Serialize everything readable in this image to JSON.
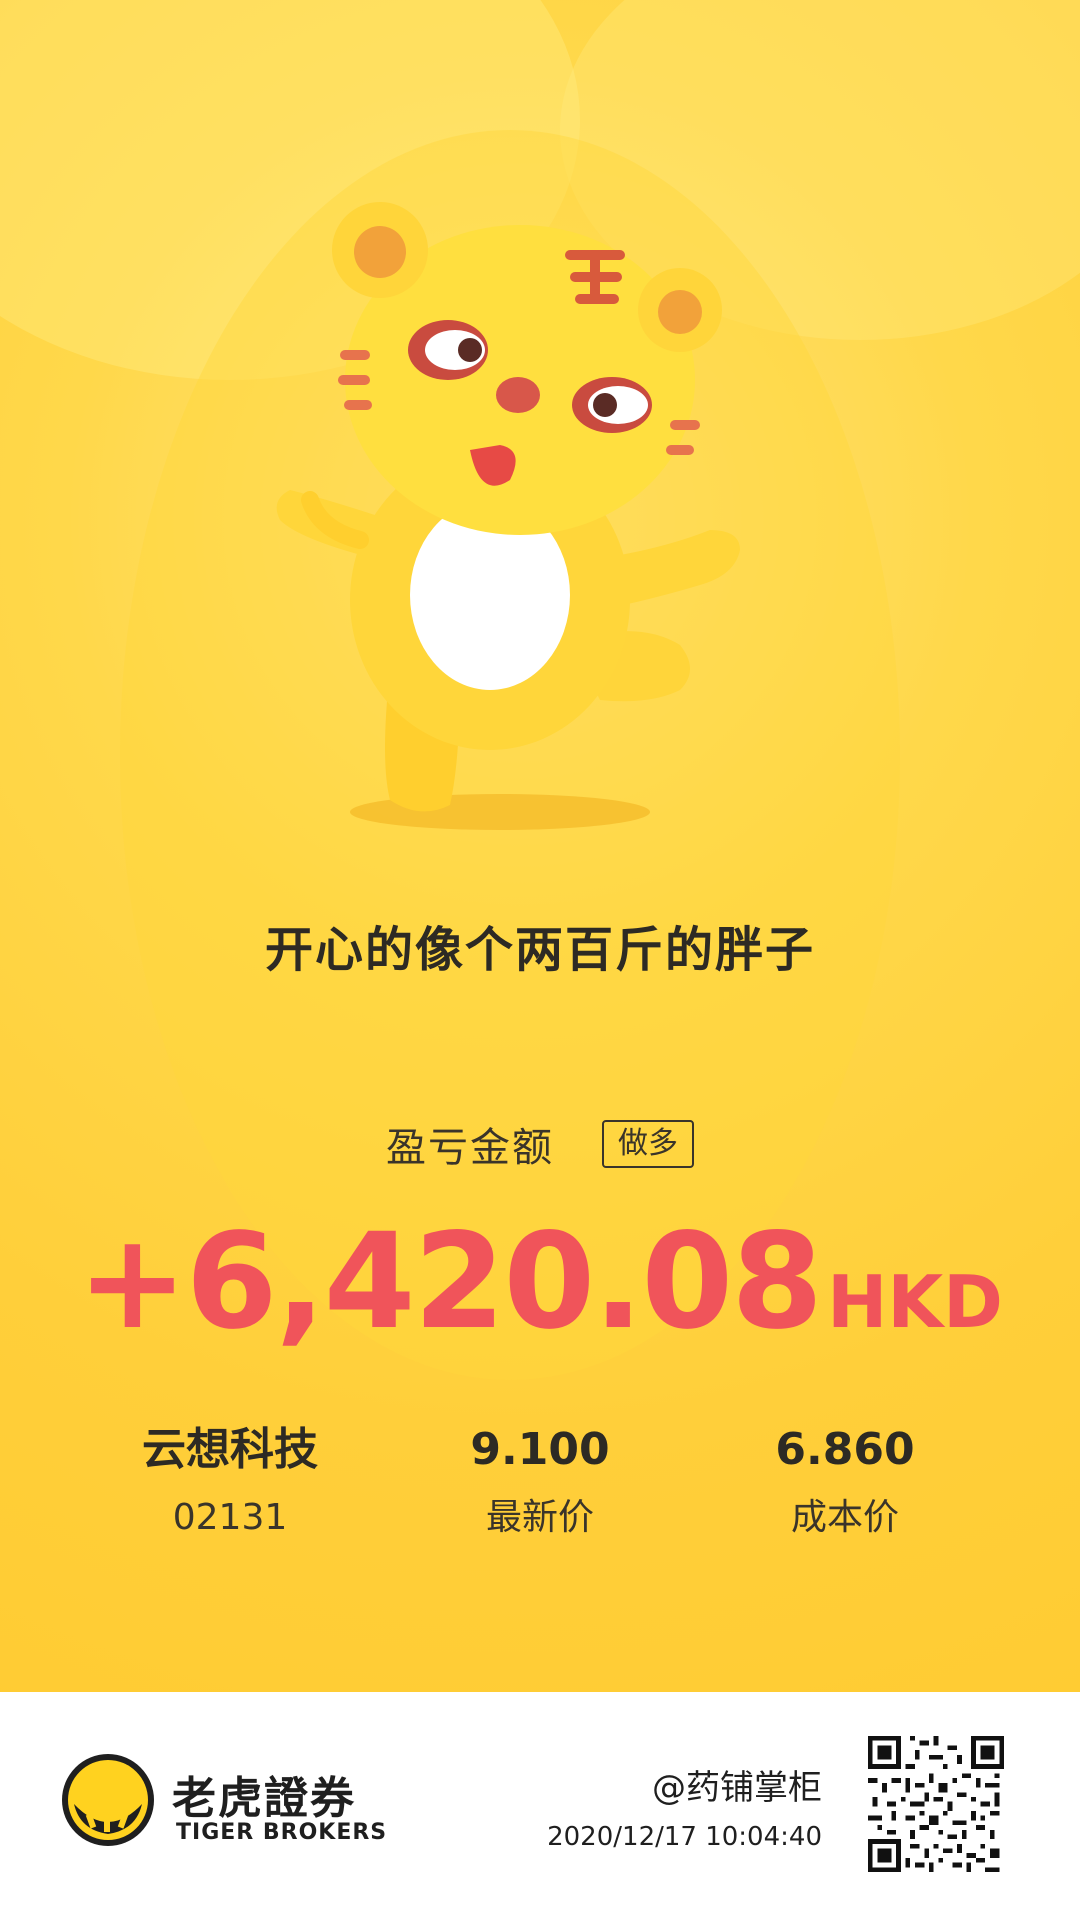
{
  "headline": "开心的像个两百斤的胖子",
  "pnl": {
    "label": "盈亏金额",
    "badge": "做多",
    "amount": "+6,420.08",
    "currency": "HKD"
  },
  "stock": {
    "name": "云想科技",
    "code": "02131"
  },
  "latest_price": {
    "value": "9.100",
    "label": "最新价"
  },
  "cost_price": {
    "value": "6.860",
    "label": "成本价"
  },
  "footer": {
    "brand_cn": "老虎證券",
    "brand_en": "TIGER BROKERS",
    "user_handle": "@药铺掌柜",
    "timestamp": "2020/12/17 10:04:40"
  },
  "colors": {
    "background": "#ffcc33",
    "profit": "#f0545a",
    "text_dark": "#2d2a24"
  },
  "icons": {
    "mascot": "tiger-mascot",
    "logo": "tiger-brokers-logo-icon",
    "qr": "qr-code"
  }
}
